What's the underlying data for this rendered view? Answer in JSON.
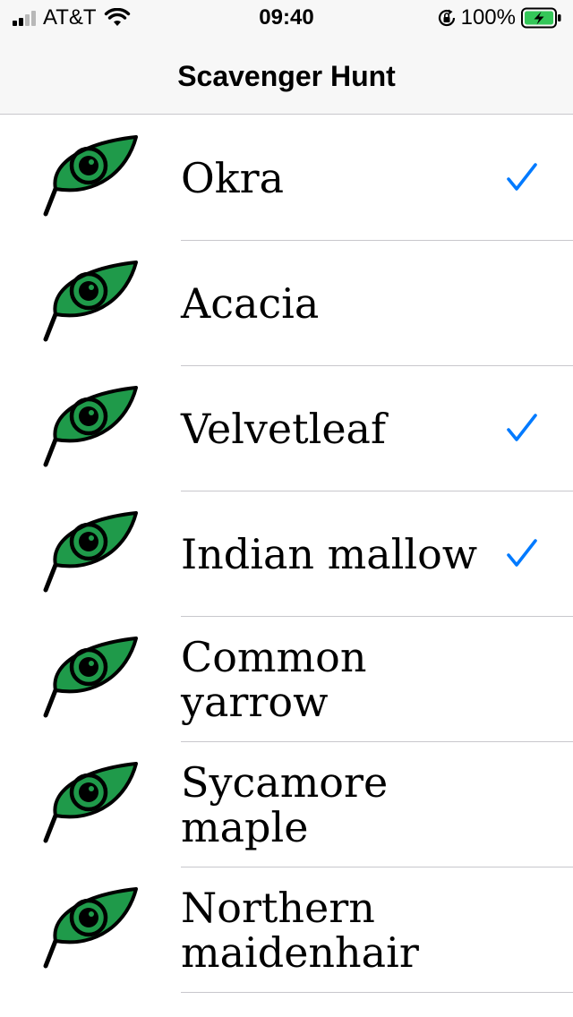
{
  "status_bar": {
    "carrier": "AT&T",
    "time": "09:40",
    "battery_percent": "100%"
  },
  "nav": {
    "title": "Scavenger Hunt"
  },
  "colors": {
    "accent": "#007aff",
    "leaf_green": "#1f9a4a",
    "separator": "#c8c7cc"
  },
  "items": [
    {
      "label": "Okra",
      "checked": true,
      "icon": "leaf-eye-icon"
    },
    {
      "label": "Acacia",
      "checked": false,
      "icon": "leaf-eye-icon"
    },
    {
      "label": "Velvetleaf",
      "checked": true,
      "icon": "leaf-eye-icon"
    },
    {
      "label": "Indian mallow",
      "checked": true,
      "icon": "leaf-eye-icon"
    },
    {
      "label": "Common yarrow",
      "checked": false,
      "icon": "leaf-eye-icon"
    },
    {
      "label": "Sycamore maple",
      "checked": false,
      "icon": "leaf-eye-icon"
    },
    {
      "label": "Northern maidenhair",
      "checked": false,
      "icon": "leaf-eye-icon"
    }
  ]
}
